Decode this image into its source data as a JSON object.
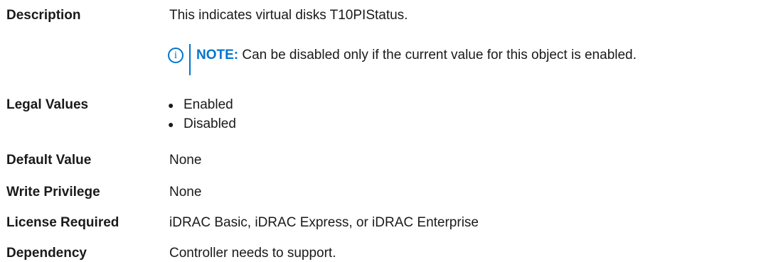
{
  "description": {
    "label": "Description",
    "text": "This indicates virtual disks T10PIStatus.",
    "note": {
      "icon": "info-icon",
      "prefix": "NOTE:",
      "text": "Can be disabled only if the current value for this object is enabled."
    }
  },
  "legal_values": {
    "label": "Legal Values",
    "items": [
      "Enabled",
      "Disabled"
    ]
  },
  "default_value": {
    "label": "Default Value",
    "value": "None"
  },
  "write_privilege": {
    "label": "Write Privilege",
    "value": "None"
  },
  "license_required": {
    "label": "License Required",
    "value": "iDRAC Basic, iDRAC Express, or iDRAC Enterprise"
  },
  "dependency": {
    "label": "Dependency",
    "value": "Controller needs to support."
  },
  "colors": {
    "accent": "#0076ce",
    "text": "#1a1a1a"
  }
}
